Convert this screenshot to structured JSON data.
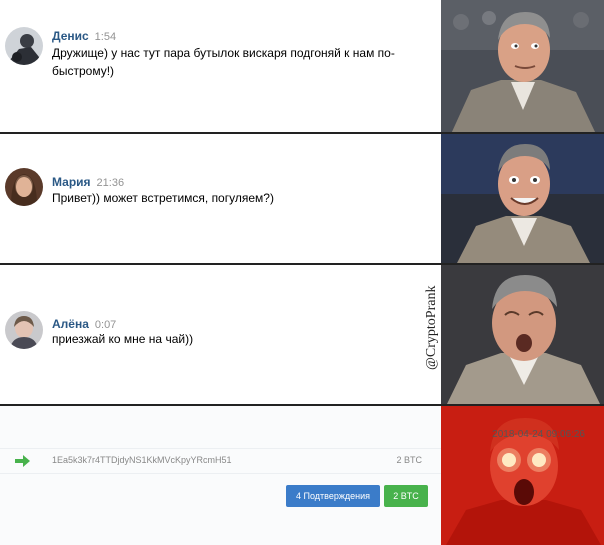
{
  "chats": [
    {
      "name": "Денис",
      "time": "1:54",
      "text_line1": "Дружище) у нас тут пара бутылок вискаря подгоняй к нам по-",
      "text_line2": "быстрому!)"
    },
    {
      "name": "Мария",
      "time": "21:36",
      "text_line1": "Привет)) может встретимся, погуляем?)"
    },
    {
      "name": "Алёна",
      "time": "0:07",
      "text_line1": "приезжай ко мне на чай))"
    }
  ],
  "watermark": "@CryptoPrank",
  "transaction": {
    "date": "2018-04-24 09:06:26",
    "address": "1Ea5k3k7r4TTDjdyNS1KkMVcKpyYRcmH51",
    "amount": "2 BTC",
    "confirmations_label": "4 Подтверждения",
    "amount_button": "2 BTC"
  },
  "colors": {
    "name_link": "#2a5885",
    "confirm_btn": "#3b7cc9",
    "amount_btn": "#48b24c",
    "arrow": "#48b24c"
  },
  "icons": [
    "arrow-right-icon"
  ]
}
